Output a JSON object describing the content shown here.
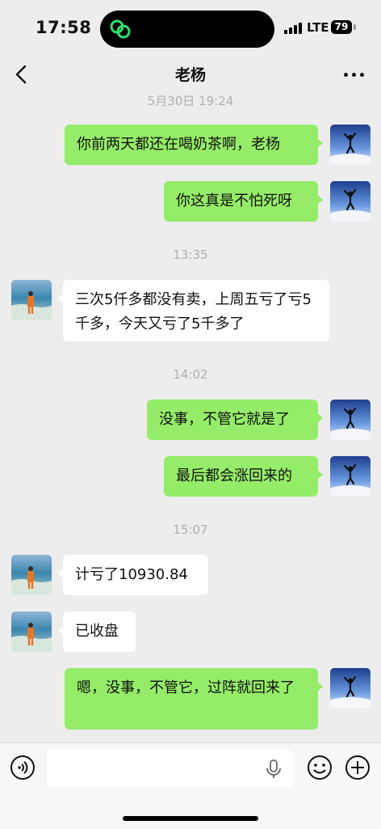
{
  "status_bar": {
    "time": "17:58",
    "network": "LTE",
    "battery": "79"
  },
  "nav": {
    "title": "老杨"
  },
  "chat": {
    "timestamps": [
      "5月30日 19:24",
      "13:35",
      "14:02",
      "15:07"
    ],
    "messages": [
      {
        "side": "me",
        "text": "你前两天都还在喝奶茶啊，老杨"
      },
      {
        "side": "me",
        "text": "你这真是不怕死呀"
      },
      {
        "side": "them",
        "text": "三次5仟多都没有卖，上周五亏了亏5千多，今天又亏了5千多了"
      },
      {
        "side": "me",
        "text": "没事，不管它就是了"
      },
      {
        "side": "me",
        "text": "最后都会涨回来的"
      },
      {
        "side": "them",
        "text": "计亏了10930.84"
      },
      {
        "side": "them",
        "text": "已收盘"
      },
      {
        "side": "me",
        "text": "嗯，没事，不管它，过阵就回来了"
      }
    ]
  },
  "colors": {
    "my_bubble": "#95ec69",
    "their_bubble": "#ffffff",
    "background": "#ededed"
  },
  "input_bar": {
    "icons": [
      "voice-icon",
      "microphone-icon",
      "emoji-icon",
      "plus-icon"
    ]
  }
}
